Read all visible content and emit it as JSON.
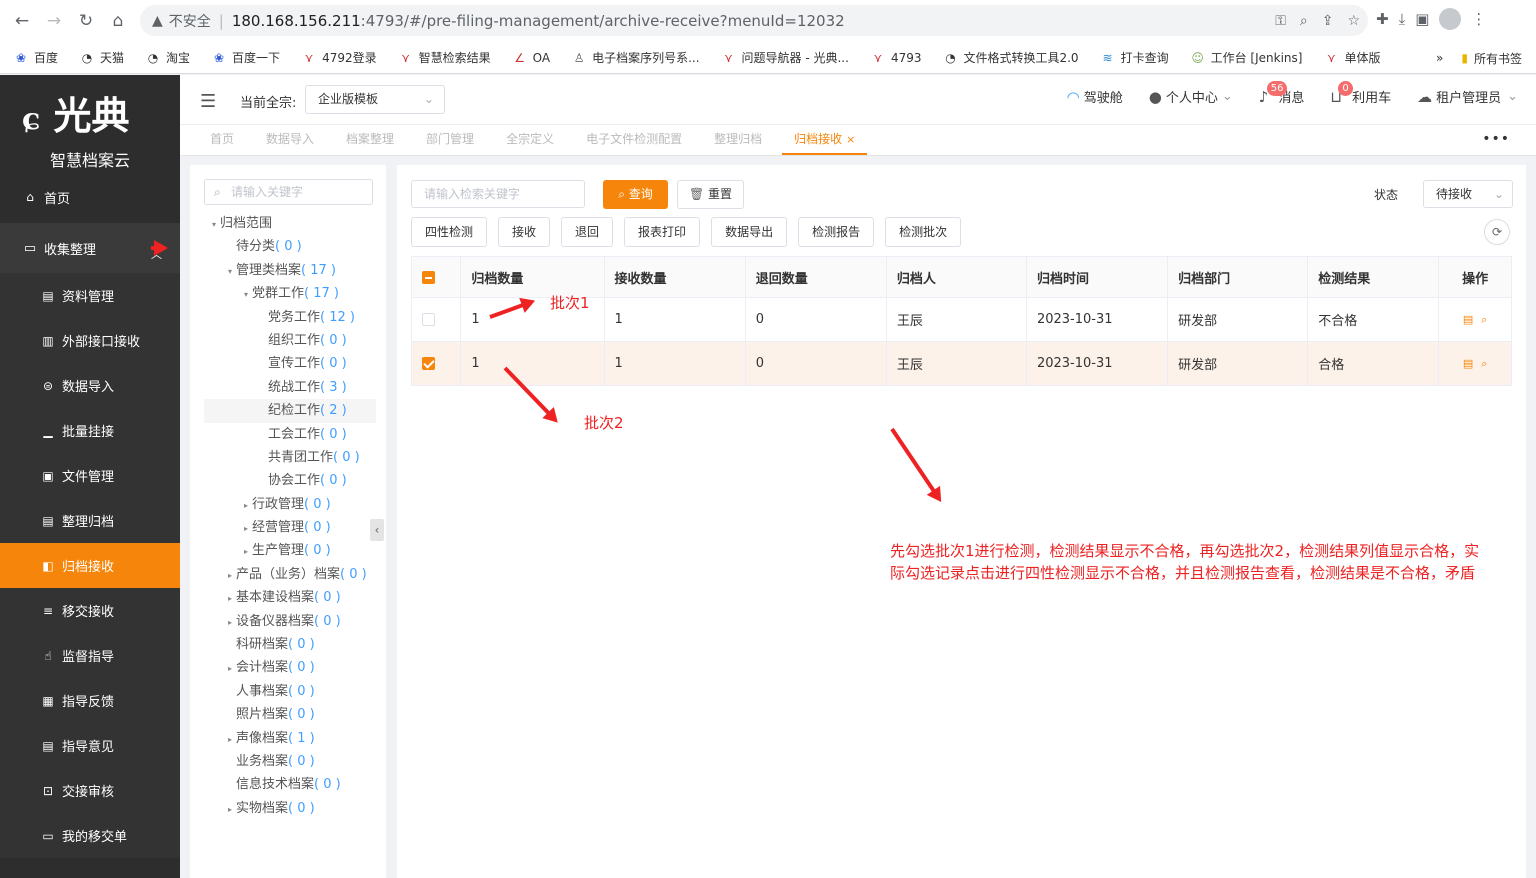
{
  "browser": {
    "insecure_label": "不安全",
    "url_host": "180.168.156.211",
    "url_rest": ":4793/#/pre-filing-management/archive-receive?menuId=12032",
    "bookmarks": [
      "百度",
      "天猫",
      "淘宝",
      "百度一下",
      "4792登录",
      "智慧检索结果",
      "OA",
      "电子档案序列号系...",
      "问题导航器 - 光典...",
      "4793",
      "文件格式转换工具2.0",
      "打卡查询",
      "工作台 [Jenkins]",
      "单体版"
    ],
    "all_bookmarks": "所有书签"
  },
  "app": {
    "logo_text": "光典",
    "logo_sub": "智慧档案云"
  },
  "sidebar": {
    "home": "首页",
    "group": "收集整理",
    "items": [
      "资料管理",
      "外部接口接收",
      "数据导入",
      "批量挂接",
      "文件管理",
      "整理归档",
      "归档接收",
      "移交接收",
      "监督指导",
      "指导反馈",
      "指导意见",
      "交接审核",
      "我的移交单"
    ]
  },
  "topbar": {
    "qz_label": "当前全宗:",
    "qz_value": "企业版模板",
    "cockpit": "驾驶舱",
    "personal": "个人中心",
    "msg": "消息",
    "msg_count": "56",
    "cart": "利用车",
    "cart_count": "0",
    "tenant": "租户管理员"
  },
  "tabs": [
    "首页",
    "数据导入",
    "档案整理",
    "部门管理",
    "全宗定义",
    "电子文件检测配置",
    "整理归档",
    "归档接收"
  ],
  "tree": {
    "search_placeholder": "请输入关键字",
    "nodes": [
      {
        "label": "归档范围",
        "count": ""
      },
      {
        "label": "待分类",
        "count": "( 0 )"
      },
      {
        "label": "管理类档案",
        "count": "( 17 )"
      },
      {
        "label": "党群工作",
        "count": "( 17 )"
      },
      {
        "label": "党务工作",
        "count": "( 12 )"
      },
      {
        "label": "组织工作",
        "count": "( 0 )"
      },
      {
        "label": "宣传工作",
        "count": "( 0 )"
      },
      {
        "label": "统战工作",
        "count": "( 3 )"
      },
      {
        "label": "纪检工作",
        "count": "( 2 )"
      },
      {
        "label": "工会工作",
        "count": "( 0 )"
      },
      {
        "label": "共青团工作",
        "count": "( 0 )"
      },
      {
        "label": "协会工作",
        "count": "( 0 )"
      },
      {
        "label": "行政管理",
        "count": "( 0 )"
      },
      {
        "label": "经营管理",
        "count": "( 0 )"
      },
      {
        "label": "生产管理",
        "count": "( 0 )"
      },
      {
        "label": "产品（业务）档案",
        "count": "( 0 )"
      },
      {
        "label": "基本建设档案",
        "count": "( 0 )"
      },
      {
        "label": "设备仪器档案",
        "count": "( 0 )"
      },
      {
        "label": "科研档案",
        "count": "( 0 )"
      },
      {
        "label": "会计档案",
        "count": "( 0 )"
      },
      {
        "label": "人事档案",
        "count": "( 0 )"
      },
      {
        "label": "照片档案",
        "count": "( 0 )"
      },
      {
        "label": "声像档案",
        "count": "( 1 )"
      },
      {
        "label": "业务档案",
        "count": "( 0 )"
      },
      {
        "label": "信息技术档案",
        "count": "( 0 )"
      },
      {
        "label": "实物档案",
        "count": "( 0 )"
      }
    ]
  },
  "main": {
    "search_placeholder": "请输入检索关键字",
    "query_btn": "查询",
    "reset_btn": "重置",
    "status_label": "状态",
    "status_value": "待接收",
    "actions": [
      "四性检测",
      "接收",
      "退回",
      "报表打印",
      "数据导出",
      "检测报告",
      "检测批次"
    ],
    "columns": [
      "归档数量",
      "接收数量",
      "退回数量",
      "归档人",
      "归档时间",
      "归档部门",
      "检测结果",
      "操作"
    ],
    "rows": [
      {
        "archive_count": "1",
        "receive_count": "1",
        "return_count": "0",
        "person": "王辰",
        "time": "2023-10-31",
        "dept": "研发部",
        "result": "不合格"
      },
      {
        "archive_count": "1",
        "receive_count": "1",
        "return_count": "0",
        "person": "王辰",
        "time": "2023-10-31",
        "dept": "研发部",
        "result": "合格"
      }
    ]
  },
  "annotations": {
    "batch1": "批次1",
    "batch2": "批次2",
    "note_line1": "先勾选批次1进行检测，检测结果显示不合格，再勾选批次2，检测结果列值显示合格，实",
    "note_line2": "际勾选记录点击进行四性检测显示不合格，并且检测报告查看，检测结果是不合格，矛盾"
  }
}
